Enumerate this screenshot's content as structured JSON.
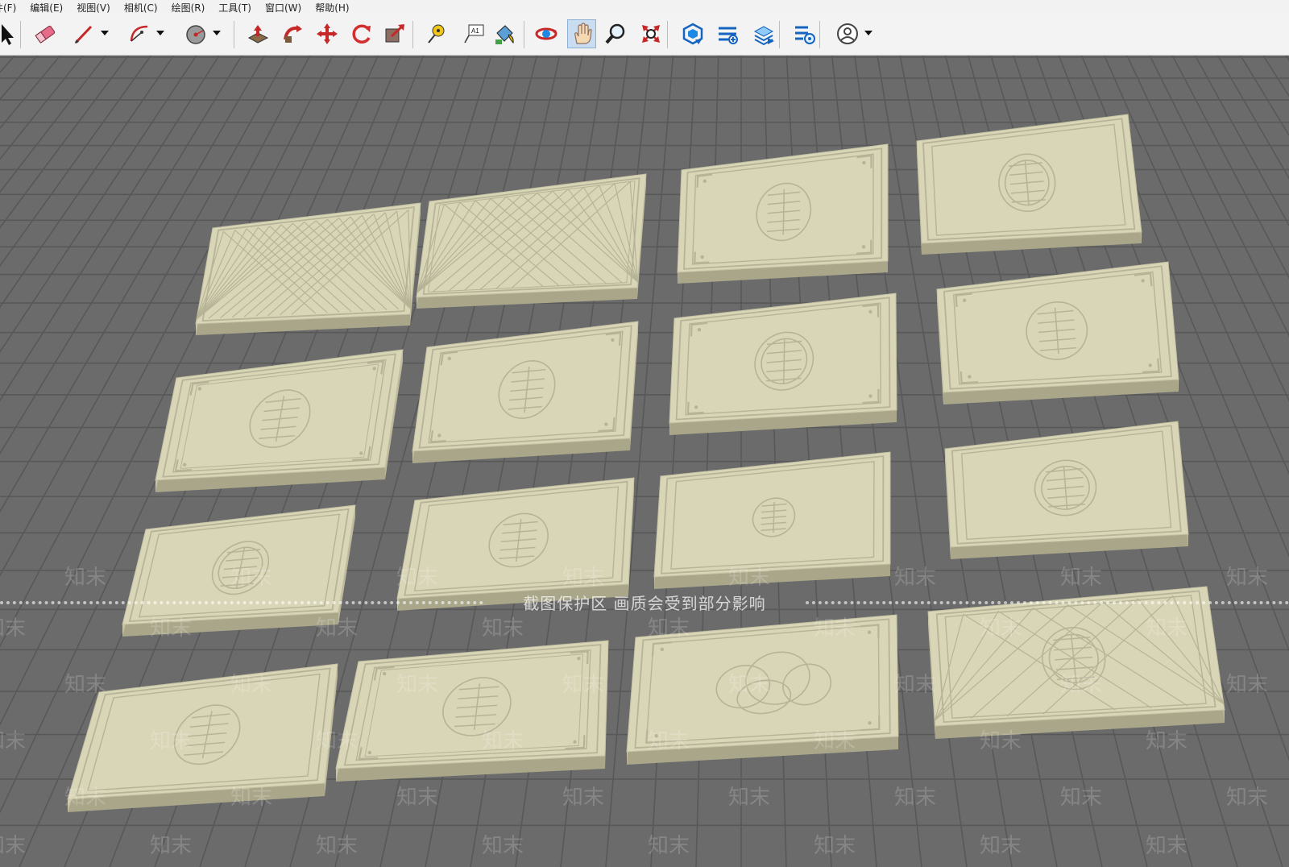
{
  "menu": [
    "件(F)",
    "编辑(E)",
    "视图(V)",
    "相机(C)",
    "绘图(R)",
    "工具(T)",
    "窗口(W)",
    "帮助(H)"
  ],
  "toolbar": {
    "tools": [
      {
        "name": "select-arrow-icon"
      },
      {
        "name": "eraser-icon"
      },
      {
        "name": "pencil-line-icon",
        "dropdown": true
      },
      {
        "name": "arc-icon",
        "dropdown": true
      },
      {
        "name": "circle-shape-icon",
        "dropdown": true
      },
      {
        "name": "push-pull-icon"
      },
      {
        "name": "follow-me-icon"
      },
      {
        "name": "move-icon"
      },
      {
        "name": "rotate-icon"
      },
      {
        "name": "scale-icon"
      },
      {
        "name": "tape-measure-icon"
      },
      {
        "name": "text-icon",
        "label": "A1"
      },
      {
        "name": "paint-bucket-icon"
      },
      {
        "name": "orbit-icon"
      },
      {
        "name": "pan-hand-icon",
        "active": true
      },
      {
        "name": "zoom-icon"
      },
      {
        "name": "zoom-extents-icon"
      },
      {
        "name": "3d-warehouse-icon"
      },
      {
        "name": "extension-warehouse-icon"
      },
      {
        "name": "layout-send-icon"
      },
      {
        "name": "extension-manager-icon"
      },
      {
        "name": "account-user-icon",
        "dropdown": true
      }
    ]
  },
  "overlay": {
    "protection_text": "截图保护区  画质会受到部分影响",
    "watermark": "知末"
  },
  "colors": {
    "ground": "#6b6b6b",
    "grid_line": "#585858",
    "panel_top": "#d9d6b7",
    "panel_side": "#a9a68a",
    "panel_edge": "#c3c0a2",
    "relief": "#b6b397",
    "toolbar_bg": "#f3f3f3"
  },
  "scene": {
    "panel_count": 16,
    "patterns": [
      "lattice",
      "weave",
      "round-seal-corners",
      "square-seal-frame",
      "fretwork-fu-seal",
      "shou-seal-corners",
      "ring-seal-corners",
      "shou-seal-cloud-corners",
      "ornate-roundel",
      "shou-seal-frame",
      "small-shou-seal",
      "faint-roundel",
      "cross-shou-seal",
      "round-seal-fret",
      "cloud-scroll",
      "shou-seal-crosshatch"
    ]
  }
}
